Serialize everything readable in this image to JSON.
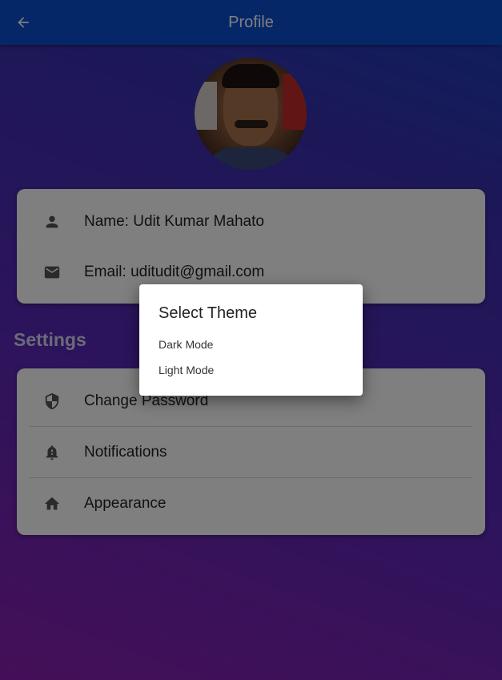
{
  "appbar": {
    "title": "Profile",
    "back_icon": "arrow-left-icon"
  },
  "profile": {
    "avatar_alt": "profile photo",
    "items": [
      {
        "icon": "person-icon",
        "label": "Name: Udit Kumar Mahato"
      },
      {
        "icon": "email-icon",
        "label": "Email: uditudit@gmail.com"
      }
    ]
  },
  "settings": {
    "title": "Settings",
    "items": [
      {
        "icon": "shield-icon",
        "label": "Change Password"
      },
      {
        "icon": "bell-icon",
        "label": "Notifications"
      },
      {
        "icon": "home-icon",
        "label": "Appearance"
      }
    ]
  },
  "theme_dialog": {
    "title": "Select Theme",
    "options": [
      "Dark Mode",
      "Light Mode"
    ]
  },
  "colors": {
    "appbar": "#0b4fd0",
    "gradient_top": "#1a3fb8",
    "gradient_bottom": "#8a1fb0",
    "card": "#ffffff",
    "scrim": "rgba(0,0,0,0.5)"
  }
}
